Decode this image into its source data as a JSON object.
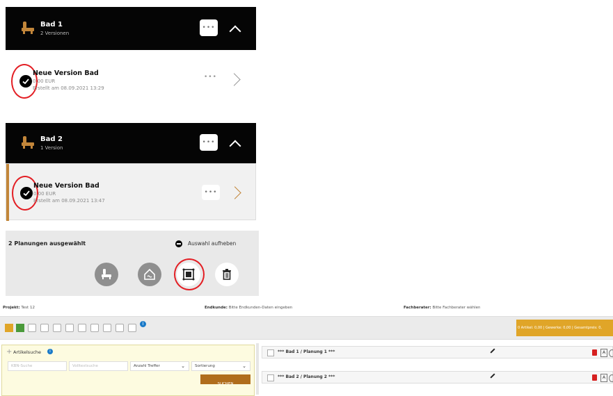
{
  "groups": [
    {
      "title": "Bad 1",
      "subtitle": "2 Versionen",
      "menu_dots": "•••",
      "version": {
        "title": "Neue Version Bad",
        "price": "0,00 EUR",
        "created": "Erstellt am 08.09.2021 13:29",
        "menu_dots": "•••"
      }
    },
    {
      "title": "Bad 2",
      "subtitle": "1 Version",
      "menu_dots": "•••",
      "version": {
        "title": "Neue Version Bad",
        "price": "0,00 EUR",
        "created": "Erstellt am 08.09.2021 13:47",
        "menu_dots": "•••"
      }
    }
  ],
  "selection_bar": {
    "count_label": "2 Planungen ausgewählt",
    "clear_label": "Auswahl aufheben",
    "actions": [
      "bathtub-icon",
      "house-icon",
      "merge-icon",
      "trash-icon"
    ]
  },
  "erp": {
    "project": {
      "label": "Projekt:",
      "value": "Test 12"
    },
    "customer": {
      "label": "Endkunde:",
      "value": "Bitte Endkunden-Daten eingeben"
    },
    "consultant": {
      "label": "Fachberater:",
      "value": "Bitte Fachberater wählen"
    },
    "summary_banner": "0 Artikel: 0,00 | Gewerke: 0,00 | Gesamtpreis: 0,",
    "search": {
      "title": "Artikelsuche",
      "field1_placeholder": "KBN-Suche",
      "field2_placeholder": "Volltextsuche",
      "hits_label": "Anzahl Treffer",
      "sort_label": "Sortierung",
      "submit_label": "SUCHEN"
    },
    "plannings": [
      "*** Bad 1 / Planung 1 ***",
      "*** Bad 2 / Planung 2 ***"
    ],
    "colors": {
      "accent": "#e0a528",
      "selection_ring": "#e31e24",
      "header_bg": "#050505",
      "gold_bar": "#c2863a"
    }
  }
}
